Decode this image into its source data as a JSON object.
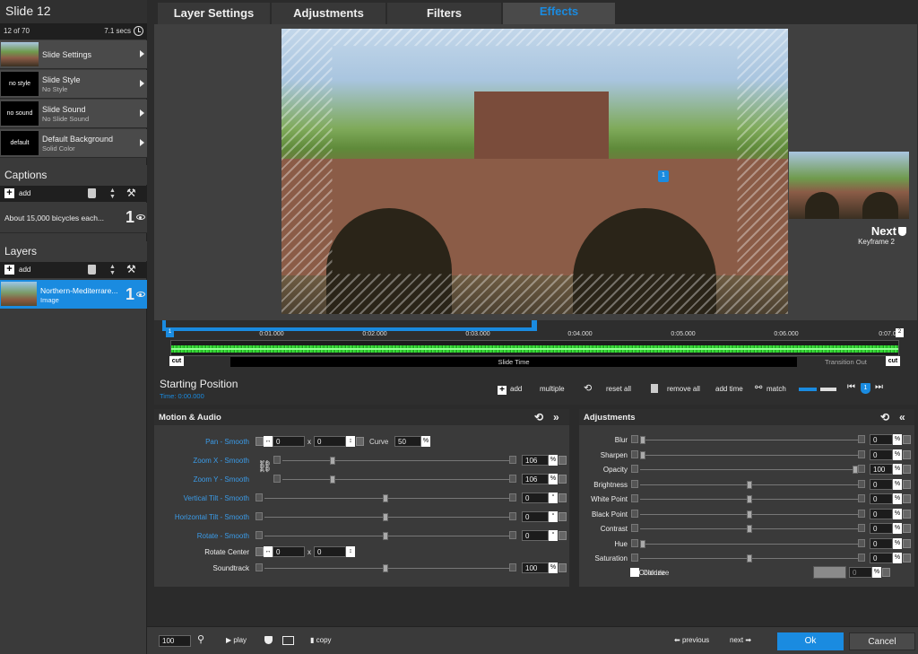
{
  "left": {
    "slide_title": "Slide 12",
    "slide_count": "12 of 70",
    "slide_duration": "7.1 secs",
    "settings_rows": [
      {
        "thumb": "",
        "label": "Slide Settings",
        "sub": ""
      },
      {
        "thumb": "no style",
        "label": "Slide Style",
        "sub": "No Style"
      },
      {
        "thumb": "no sound",
        "label": "Slide Sound",
        "sub": "No Slide Sound"
      },
      {
        "thumb": "default",
        "label": "Default Background",
        "sub": "Solid Color"
      }
    ],
    "captions_title": "Captions",
    "add_label": "add",
    "caption_text": "About 15,000 bicycles each...",
    "caption_num": "1",
    "layers_title": "Layers",
    "layer_name": "Northern-Mediterrare...",
    "layer_type": "Image",
    "layer_num": "1"
  },
  "tabs": [
    "Layer Settings",
    "Adjustments",
    "Filters",
    "Effects"
  ],
  "stage": {
    "next_label": "Next",
    "next_sub": "Keyframe 2",
    "keyframe_marker": "1"
  },
  "timeline": {
    "ticks": [
      "0:01.000",
      "0:02.000",
      "0:03.000",
      "0:04.000",
      "0:05.000",
      "0:06.000",
      "0:07.0"
    ],
    "cut": "cut",
    "slide_time": "Slide Time",
    "transition_out": "Transition Out",
    "pin_start": "1",
    "pin_end": "2"
  },
  "starting_position": {
    "title": "Starting Position",
    "time": "Time: 0:00.000",
    "add": "add",
    "multiple": "multiple",
    "reset_all": "reset all",
    "remove_all": "remove all",
    "add_time": "add time",
    "match": "match",
    "kf": "1"
  },
  "motion": {
    "title": "Motion & Audio",
    "pan_label": "Pan - Smooth",
    "pan_x": "0",
    "pan_y": "0",
    "x_sep": "x",
    "curve_label": "Curve",
    "curve_value": "50",
    "percent": "%",
    "rows": [
      {
        "label": "Zoom X - Smooth",
        "value": "106",
        "unit": "%"
      },
      {
        "label": "Zoom Y - Smooth",
        "value": "106",
        "unit": "%"
      },
      {
        "label": "Vertical Tilt - Smooth",
        "value": "0",
        "unit": "°"
      },
      {
        "label": "Horizontal Tilt - Smooth",
        "value": "0",
        "unit": "°"
      },
      {
        "label": "Rotate - Smooth",
        "value": "0",
        "unit": "°"
      }
    ],
    "rotate_center_label": "Rotate Center",
    "rc_x": "0",
    "rc_y": "0",
    "soundtrack_label": "Soundtrack",
    "soundtrack_value": "100"
  },
  "adjustments": {
    "title": "Adjustments",
    "rows": [
      {
        "label": "Blur",
        "value": "0",
        "level": 0
      },
      {
        "label": "Sharpen",
        "value": "0",
        "level": 0
      },
      {
        "label": "Opacity",
        "value": "100",
        "level": 100
      },
      {
        "label": "Brightness",
        "value": "0",
        "level": 50
      },
      {
        "label": "White Point",
        "value": "0",
        "level": 50
      },
      {
        "label": "Black Point",
        "value": "0",
        "level": 50
      },
      {
        "label": "Contrast",
        "value": "0",
        "level": 50
      },
      {
        "label": "Hue",
        "value": "0",
        "level": 0
      },
      {
        "label": "Saturation",
        "value": "0",
        "level": 50
      }
    ],
    "colorize_label": "Colorize",
    "colorize_check_label": "Colorize",
    "colorize_value": "0",
    "percent": "%"
  },
  "bottom": {
    "zoom": "100",
    "play": "play",
    "copy": "copy",
    "previous": "previous",
    "next": "next",
    "ok": "Ok",
    "cancel": "Cancel"
  },
  "colors": {
    "accent": "#1a8be0",
    "waveform": "#2fd12f"
  }
}
